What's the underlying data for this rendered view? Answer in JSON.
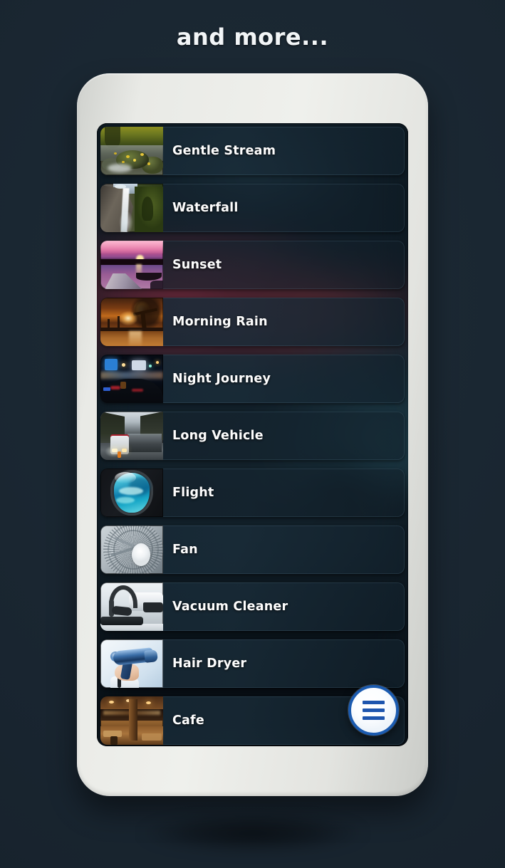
{
  "page": {
    "title": "and more...",
    "background_color": "#1a2630"
  },
  "device": {
    "frame_color": "#e9eae6",
    "screen_background": "#0d171f"
  },
  "list": {
    "items": [
      {
        "label": "Gentle Stream",
        "thumb": "forest-stream-thumb",
        "highlight": true
      },
      {
        "label": "Waterfall",
        "thumb": "waterfall-thumb",
        "highlight": false
      },
      {
        "label": "Sunset",
        "thumb": "sunset-lake-thumb",
        "highlight": false
      },
      {
        "label": "Morning Rain",
        "thumb": "morning-sunrise-thumb",
        "highlight": true
      },
      {
        "label": "Night Journey",
        "thumb": "night-driving-thumb",
        "highlight": false
      },
      {
        "label": "Long Vehicle",
        "thumb": "truck-road-thumb",
        "highlight": false
      },
      {
        "label": "Flight",
        "thumb": "airplane-window-thumb",
        "highlight": false
      },
      {
        "label": "Fan",
        "thumb": "electric-fan-thumb",
        "highlight": false
      },
      {
        "label": "Vacuum Cleaner",
        "thumb": "vacuum-cleaner-thumb",
        "highlight": false
      },
      {
        "label": "Hair Dryer",
        "thumb": "hair-dryer-thumb",
        "highlight": false
      },
      {
        "label": "Cafe",
        "thumb": "cafe-interior-thumb",
        "highlight": false
      }
    ]
  },
  "fab": {
    "icon": "hamburger-menu-icon",
    "fill_color": "#ffffff",
    "accent_color": "#1b5bb0"
  }
}
